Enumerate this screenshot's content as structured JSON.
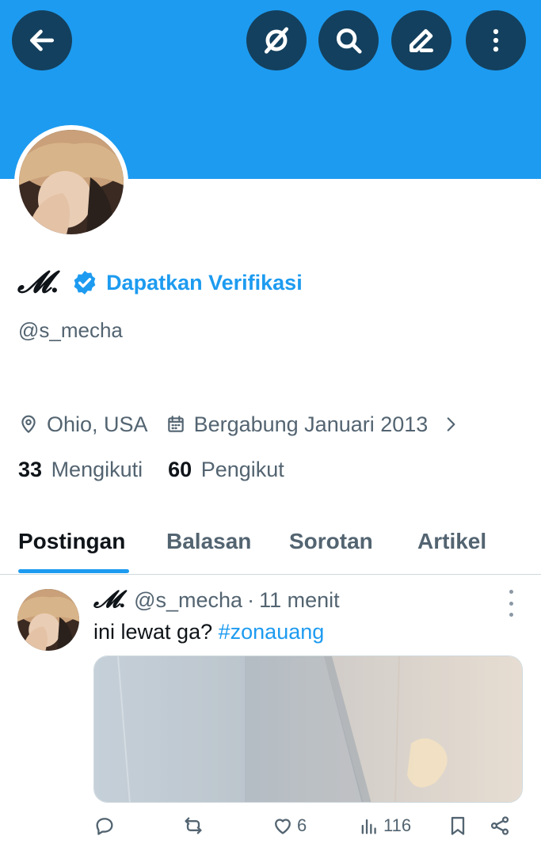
{
  "header": {
    "back_icon": "arrow-left-icon",
    "grok_icon": "grok-icon",
    "search_icon": "search-icon",
    "edit_icon": "edit-icon",
    "more_icon": "more-vertical-icon",
    "banner_color": "#1d9bf0"
  },
  "profile": {
    "display_name": "𝓜.",
    "verified_icon": "verified-badge-icon",
    "get_verified_label": "Dapatkan Verifikasi",
    "handle": "@s_mecha",
    "location": "Ohio, USA",
    "joined": "Bergabung Januari 2013",
    "following_count": "33",
    "following_label": "Mengikuti",
    "followers_count": "60",
    "followers_label": "Pengikut"
  },
  "tabs": [
    {
      "label": "Postingan",
      "active": true
    },
    {
      "label": "Balasan",
      "active": false
    },
    {
      "label": "Sorotan",
      "active": false
    },
    {
      "label": "Artikel",
      "active": false
    }
  ],
  "post": {
    "author_name": "𝓜.",
    "author_handle": "@s_mecha",
    "separator": "·",
    "time": "11 menit",
    "text": "ini lewat ga?",
    "hashtag": "#zonauang",
    "likes": "6",
    "views": "116"
  },
  "colors": {
    "accent": "#1d9bf0",
    "text_primary": "#0f1419",
    "text_secondary": "#536471"
  }
}
